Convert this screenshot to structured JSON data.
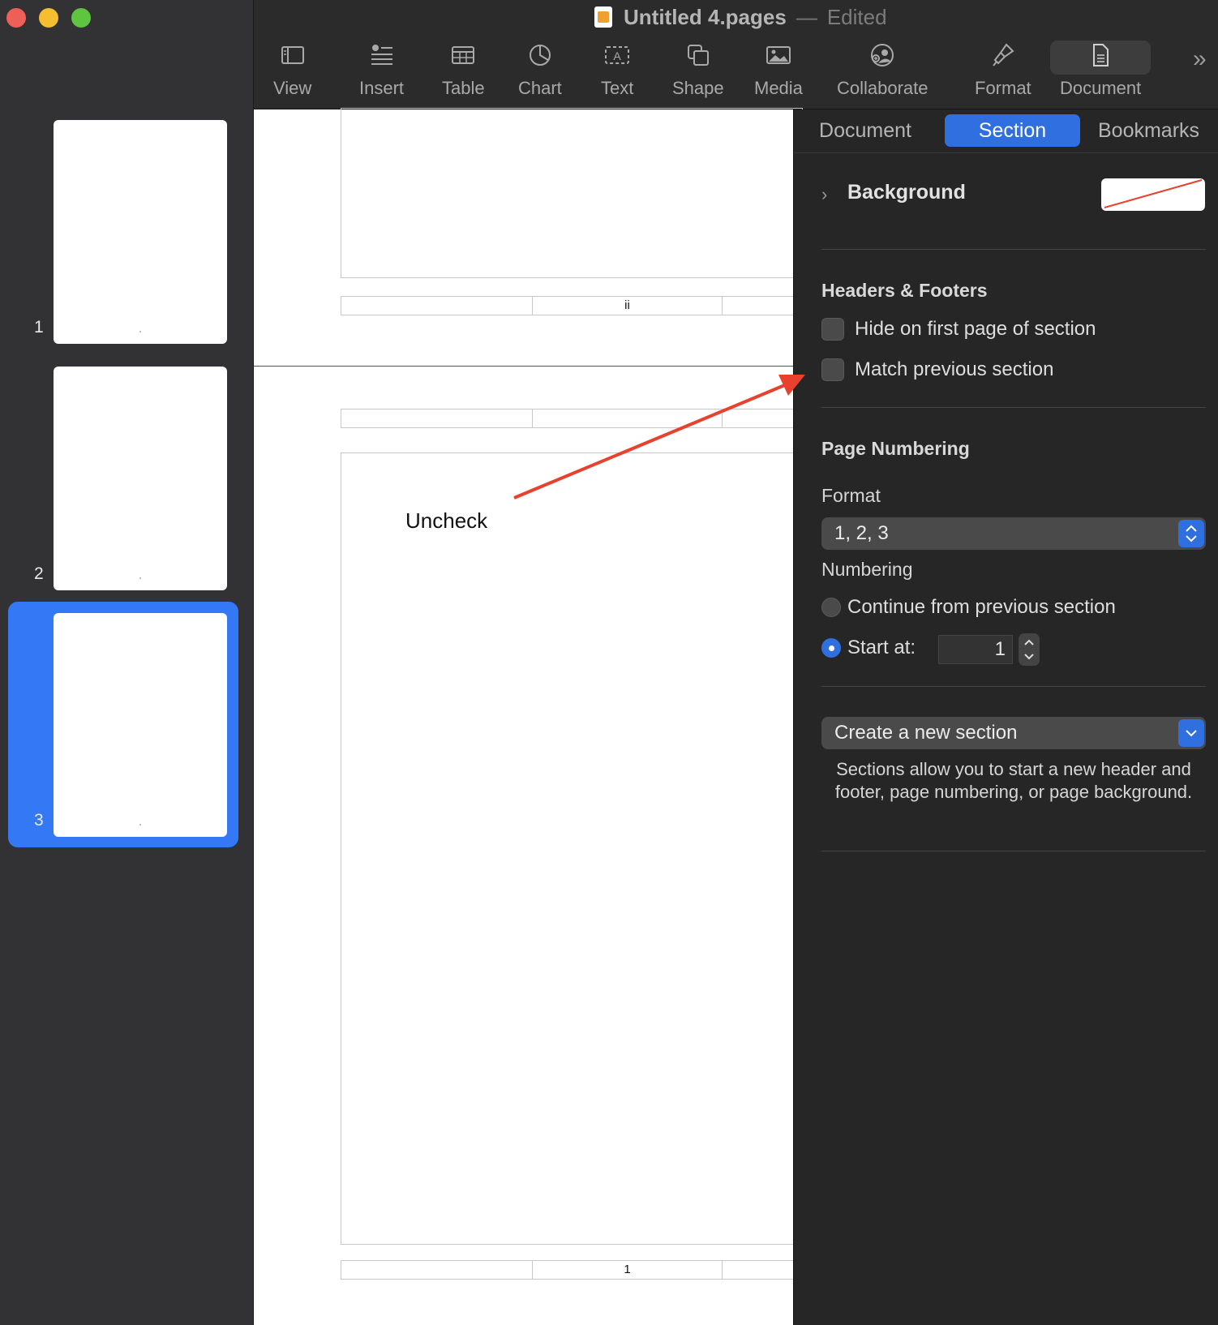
{
  "window": {
    "title": "Untitled 4.pages",
    "title_separator": "—",
    "status": "Edited"
  },
  "sidebar": {
    "pages": [
      {
        "number": "1",
        "selected": false
      },
      {
        "number": "2",
        "selected": false
      },
      {
        "number": "3",
        "selected": true
      }
    ]
  },
  "toolbar": {
    "items": [
      {
        "label": "View",
        "icon": "sidebar-icon"
      },
      {
        "label": "Insert",
        "icon": "insert-icon"
      },
      {
        "label": "Table",
        "icon": "table-icon"
      },
      {
        "label": "Chart",
        "icon": "chart-icon"
      },
      {
        "label": "Text",
        "icon": "text-box-icon"
      },
      {
        "label": "Shape",
        "icon": "shape-icon"
      },
      {
        "label": "Media",
        "icon": "image-icon"
      },
      {
        "label": "Collaborate",
        "icon": "collaborate-icon"
      },
      {
        "label": "Format",
        "icon": "paintbrush-icon"
      },
      {
        "label": "Document",
        "icon": "document-icon",
        "active": true
      }
    ],
    "more": "»"
  },
  "canvas": {
    "page2_footer_number": "ii",
    "page3_footer_number": "1",
    "annotation": "Uncheck",
    "annotation_color": "#e8412d"
  },
  "inspector": {
    "tabs": [
      {
        "label": "Document",
        "active": false
      },
      {
        "label": "Section",
        "active": true
      },
      {
        "label": "Bookmarks",
        "active": false
      }
    ],
    "background_label": "Background",
    "headers_footers": {
      "title": "Headers & Footers",
      "hide_first_page": {
        "label": "Hide on first page of section",
        "checked": false
      },
      "match_previous": {
        "label": "Match previous section",
        "checked": false
      }
    },
    "page_numbering": {
      "title": "Page Numbering",
      "format_label": "Format",
      "format_value": "1, 2, 3",
      "numbering_label": "Numbering",
      "continue_label": "Continue from previous section",
      "start_at_label": "Start at:",
      "start_at_value": "1",
      "selected_option": "start_at"
    },
    "section": {
      "create_label": "Create a new section",
      "help": "Sections allow you to start a new header and footer, page numbering, or page background."
    },
    "accent_color": "#2f6fe0"
  }
}
